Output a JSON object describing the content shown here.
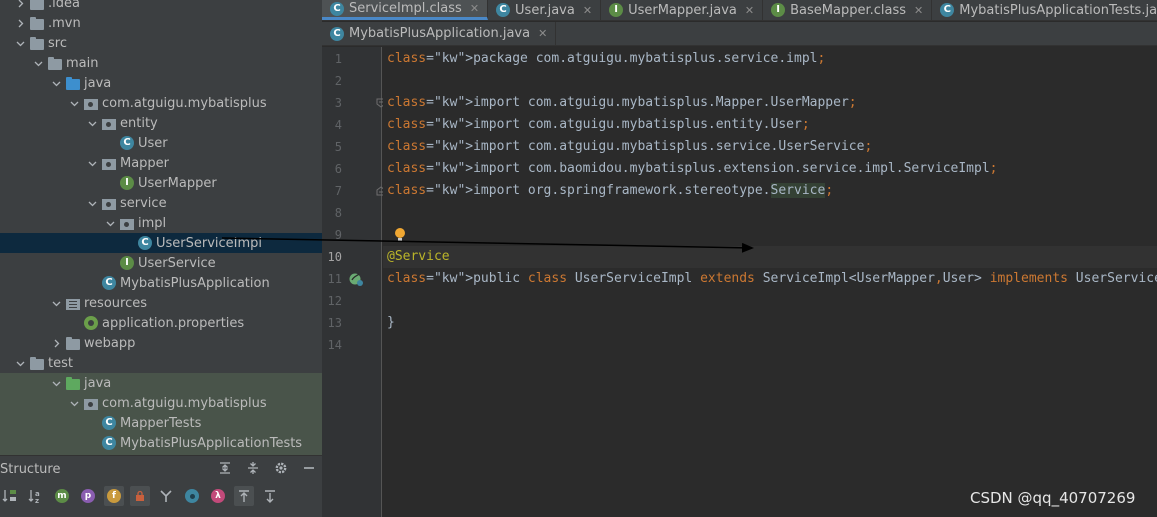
{
  "project_tree": [
    {
      "label": ".idea",
      "icon": "folder-icon"
    },
    {
      "label": ".mvn",
      "icon": "folder-icon"
    },
    {
      "label": "src",
      "icon": "folder-icon"
    },
    {
      "label": "main",
      "icon": "folder-icon"
    },
    {
      "label": "java",
      "icon": "source-folder-icon"
    },
    {
      "label": "com.atguigu.mybatisplus",
      "icon": "package-icon"
    },
    {
      "label": "entity",
      "icon": "package-icon"
    },
    {
      "label": "User",
      "icon": "class-icon"
    },
    {
      "label": "Mapper",
      "icon": "package-icon"
    },
    {
      "label": "UserMapper",
      "icon": "interface-icon"
    },
    {
      "label": "service",
      "icon": "package-icon"
    },
    {
      "label": "impl",
      "icon": "package-icon"
    },
    {
      "label": "UserServiceImpl",
      "icon": "class-icon"
    },
    {
      "label": "UserService",
      "icon": "interface-icon"
    },
    {
      "label": "MybatisPlusApplication",
      "icon": "spring-boot-class-icon"
    },
    {
      "label": "resources",
      "icon": "resources-folder-icon"
    },
    {
      "label": "application.properties",
      "icon": "properties-file-icon"
    },
    {
      "label": "webapp",
      "icon": "folder-icon"
    },
    {
      "label": "test",
      "icon": "folder-icon"
    },
    {
      "label": "java",
      "icon": "test-source-folder-icon"
    },
    {
      "label": "com.atguigu.mybatisplus",
      "icon": "package-icon"
    },
    {
      "label": "MapperTests",
      "icon": "test-class-icon"
    },
    {
      "label": "MybatisPlusApplicationTests",
      "icon": "test-class-icon"
    }
  ],
  "structure": {
    "title": "Structure",
    "icons": [
      "sort-visibility-icon",
      "sort-alphabetically-icon",
      "show-inherited-icon",
      "show-properties-icon",
      "show-fields-icon",
      "show-non-public-icon",
      "show-lambdas-icon",
      "show-anonymous-icon",
      "show-interface-icon",
      "expand-all-icon",
      "collapse-all-icon"
    ]
  },
  "tabs_row1": [
    {
      "label": "ServiceImpl.class",
      "icon": "class-icon",
      "active": true
    },
    {
      "label": "User.java",
      "icon": "class-icon",
      "active": false
    },
    {
      "label": "UserMapper.java",
      "icon": "interface-icon",
      "active": false
    },
    {
      "label": "BaseMapper.class",
      "icon": "interface-icon",
      "active": false
    },
    {
      "label": "MybatisPlusApplicationTests.java",
      "icon": "class-icon",
      "active": false
    }
  ],
  "tabs_row2": [
    {
      "label": "MybatisPlusApplication.java",
      "icon": "spring-boot-class-icon",
      "active": false
    }
  ],
  "code_lines": [
    {
      "no": "1",
      "text": "package com.atguigu.mybatisplus.service.impl;"
    },
    {
      "no": "2",
      "text": ""
    },
    {
      "no": "3",
      "text": "import com.atguigu.mybatisplus.Mapper.UserMapper;"
    },
    {
      "no": "4",
      "text": "import com.atguigu.mybatisplus.entity.User;"
    },
    {
      "no": "5",
      "text": "import com.atguigu.mybatisplus.service.UserService;"
    },
    {
      "no": "6",
      "text": "import com.baomidou.mybatisplus.extension.service.impl.ServiceImpl;"
    },
    {
      "no": "7",
      "text": "import org.springframework.stereotype.Service;"
    },
    {
      "no": "8",
      "text": ""
    },
    {
      "no": "9",
      "text": ""
    },
    {
      "no": "10",
      "text": "@Service"
    },
    {
      "no": "11",
      "text": "public class UserServiceImpl extends ServiceImpl<UserMapper,User> implements UserService{"
    },
    {
      "no": "12",
      "text": ""
    },
    {
      "no": "13",
      "text": "}"
    },
    {
      "no": "14",
      "text": ""
    }
  ],
  "watermark": "CSDN @qq_40707269",
  "colors": {
    "keyword": "#cc7832",
    "annotation": "#bbb529",
    "plain": "#a9b7c6",
    "selection": "#0d293e",
    "accent": "#4a88c7"
  }
}
